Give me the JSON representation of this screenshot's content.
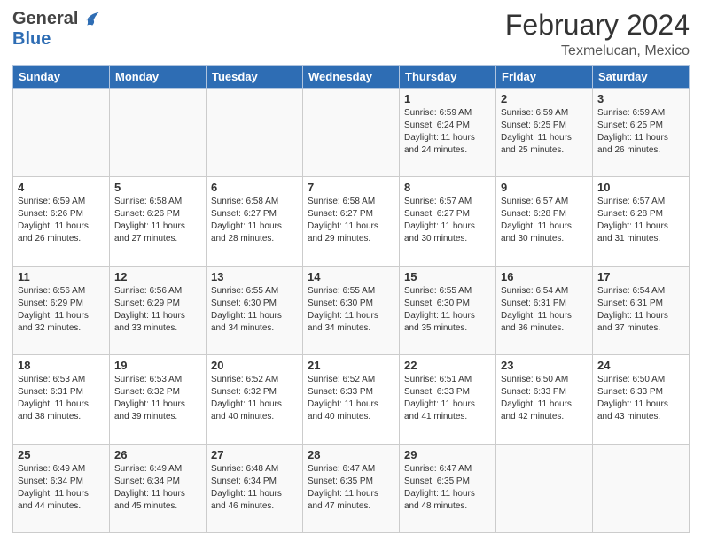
{
  "header": {
    "logo_general": "General",
    "logo_blue": "Blue",
    "month_title": "February 2024",
    "location": "Texmelucan, Mexico"
  },
  "weekdays": [
    "Sunday",
    "Monday",
    "Tuesday",
    "Wednesday",
    "Thursday",
    "Friday",
    "Saturday"
  ],
  "weeks": [
    [
      {
        "day": "",
        "info": ""
      },
      {
        "day": "",
        "info": ""
      },
      {
        "day": "",
        "info": ""
      },
      {
        "day": "",
        "info": ""
      },
      {
        "day": "1",
        "info": "Sunrise: 6:59 AM\nSunset: 6:24 PM\nDaylight: 11 hours and 24 minutes."
      },
      {
        "day": "2",
        "info": "Sunrise: 6:59 AM\nSunset: 6:25 PM\nDaylight: 11 hours and 25 minutes."
      },
      {
        "day": "3",
        "info": "Sunrise: 6:59 AM\nSunset: 6:25 PM\nDaylight: 11 hours and 26 minutes."
      }
    ],
    [
      {
        "day": "4",
        "info": "Sunrise: 6:59 AM\nSunset: 6:26 PM\nDaylight: 11 hours and 26 minutes."
      },
      {
        "day": "5",
        "info": "Sunrise: 6:58 AM\nSunset: 6:26 PM\nDaylight: 11 hours and 27 minutes."
      },
      {
        "day": "6",
        "info": "Sunrise: 6:58 AM\nSunset: 6:27 PM\nDaylight: 11 hours and 28 minutes."
      },
      {
        "day": "7",
        "info": "Sunrise: 6:58 AM\nSunset: 6:27 PM\nDaylight: 11 hours and 29 minutes."
      },
      {
        "day": "8",
        "info": "Sunrise: 6:57 AM\nSunset: 6:27 PM\nDaylight: 11 hours and 30 minutes."
      },
      {
        "day": "9",
        "info": "Sunrise: 6:57 AM\nSunset: 6:28 PM\nDaylight: 11 hours and 30 minutes."
      },
      {
        "day": "10",
        "info": "Sunrise: 6:57 AM\nSunset: 6:28 PM\nDaylight: 11 hours and 31 minutes."
      }
    ],
    [
      {
        "day": "11",
        "info": "Sunrise: 6:56 AM\nSunset: 6:29 PM\nDaylight: 11 hours and 32 minutes."
      },
      {
        "day": "12",
        "info": "Sunrise: 6:56 AM\nSunset: 6:29 PM\nDaylight: 11 hours and 33 minutes."
      },
      {
        "day": "13",
        "info": "Sunrise: 6:55 AM\nSunset: 6:30 PM\nDaylight: 11 hours and 34 minutes."
      },
      {
        "day": "14",
        "info": "Sunrise: 6:55 AM\nSunset: 6:30 PM\nDaylight: 11 hours and 34 minutes."
      },
      {
        "day": "15",
        "info": "Sunrise: 6:55 AM\nSunset: 6:30 PM\nDaylight: 11 hours and 35 minutes."
      },
      {
        "day": "16",
        "info": "Sunrise: 6:54 AM\nSunset: 6:31 PM\nDaylight: 11 hours and 36 minutes."
      },
      {
        "day": "17",
        "info": "Sunrise: 6:54 AM\nSunset: 6:31 PM\nDaylight: 11 hours and 37 minutes."
      }
    ],
    [
      {
        "day": "18",
        "info": "Sunrise: 6:53 AM\nSunset: 6:31 PM\nDaylight: 11 hours and 38 minutes."
      },
      {
        "day": "19",
        "info": "Sunrise: 6:53 AM\nSunset: 6:32 PM\nDaylight: 11 hours and 39 minutes."
      },
      {
        "day": "20",
        "info": "Sunrise: 6:52 AM\nSunset: 6:32 PM\nDaylight: 11 hours and 40 minutes."
      },
      {
        "day": "21",
        "info": "Sunrise: 6:52 AM\nSunset: 6:33 PM\nDaylight: 11 hours and 40 minutes."
      },
      {
        "day": "22",
        "info": "Sunrise: 6:51 AM\nSunset: 6:33 PM\nDaylight: 11 hours and 41 minutes."
      },
      {
        "day": "23",
        "info": "Sunrise: 6:50 AM\nSunset: 6:33 PM\nDaylight: 11 hours and 42 minutes."
      },
      {
        "day": "24",
        "info": "Sunrise: 6:50 AM\nSunset: 6:33 PM\nDaylight: 11 hours and 43 minutes."
      }
    ],
    [
      {
        "day": "25",
        "info": "Sunrise: 6:49 AM\nSunset: 6:34 PM\nDaylight: 11 hours and 44 minutes."
      },
      {
        "day": "26",
        "info": "Sunrise: 6:49 AM\nSunset: 6:34 PM\nDaylight: 11 hours and 45 minutes."
      },
      {
        "day": "27",
        "info": "Sunrise: 6:48 AM\nSunset: 6:34 PM\nDaylight: 11 hours and 46 minutes."
      },
      {
        "day": "28",
        "info": "Sunrise: 6:47 AM\nSunset: 6:35 PM\nDaylight: 11 hours and 47 minutes."
      },
      {
        "day": "29",
        "info": "Sunrise: 6:47 AM\nSunset: 6:35 PM\nDaylight: 11 hours and 48 minutes."
      },
      {
        "day": "",
        "info": ""
      },
      {
        "day": "",
        "info": ""
      }
    ]
  ]
}
